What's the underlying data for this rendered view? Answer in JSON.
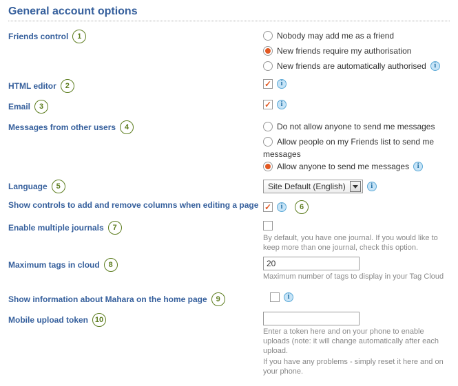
{
  "section_title": "General account options",
  "badges": {
    "b1": "1",
    "b2": "2",
    "b3": "3",
    "b4": "4",
    "b5": "5",
    "b6": "6",
    "b7": "7",
    "b8": "8",
    "b9": "9",
    "b10": "10"
  },
  "friends": {
    "label": "Friends control",
    "opt1": "Nobody may add me as a friend",
    "opt2": "New friends require my authorisation",
    "opt3": "New friends are automatically authorised"
  },
  "html_editor": {
    "label": "HTML editor"
  },
  "email": {
    "label": "Email"
  },
  "messages": {
    "label": "Messages from other users",
    "opt1": "Do not allow anyone to send me messages",
    "opt2a": "Allow people on my Friends list to send me",
    "opt2b": "messages",
    "opt3": "Allow anyone to send me messages"
  },
  "language": {
    "label": "Language",
    "selected": "Site Default (English)"
  },
  "show_controls": {
    "label": "Show controls to add and remove columns when editing a page"
  },
  "multi_journals": {
    "label": "Enable multiple journals",
    "help": "By default, you have one journal. If you would like to keep more than one journal, check this option."
  },
  "max_tags": {
    "label": "Maximum tags in cloud",
    "value": "20",
    "help": "Maximum number of tags to display in your Tag Cloud"
  },
  "show_info": {
    "label": "Show information about Mahara on the home page"
  },
  "mobile_token": {
    "label": "Mobile upload token",
    "help1": "Enter a token here and on your phone to enable uploads (note: it will change automatically after each upload.",
    "help2": "If you have any problems - simply reset it here and on your phone."
  }
}
